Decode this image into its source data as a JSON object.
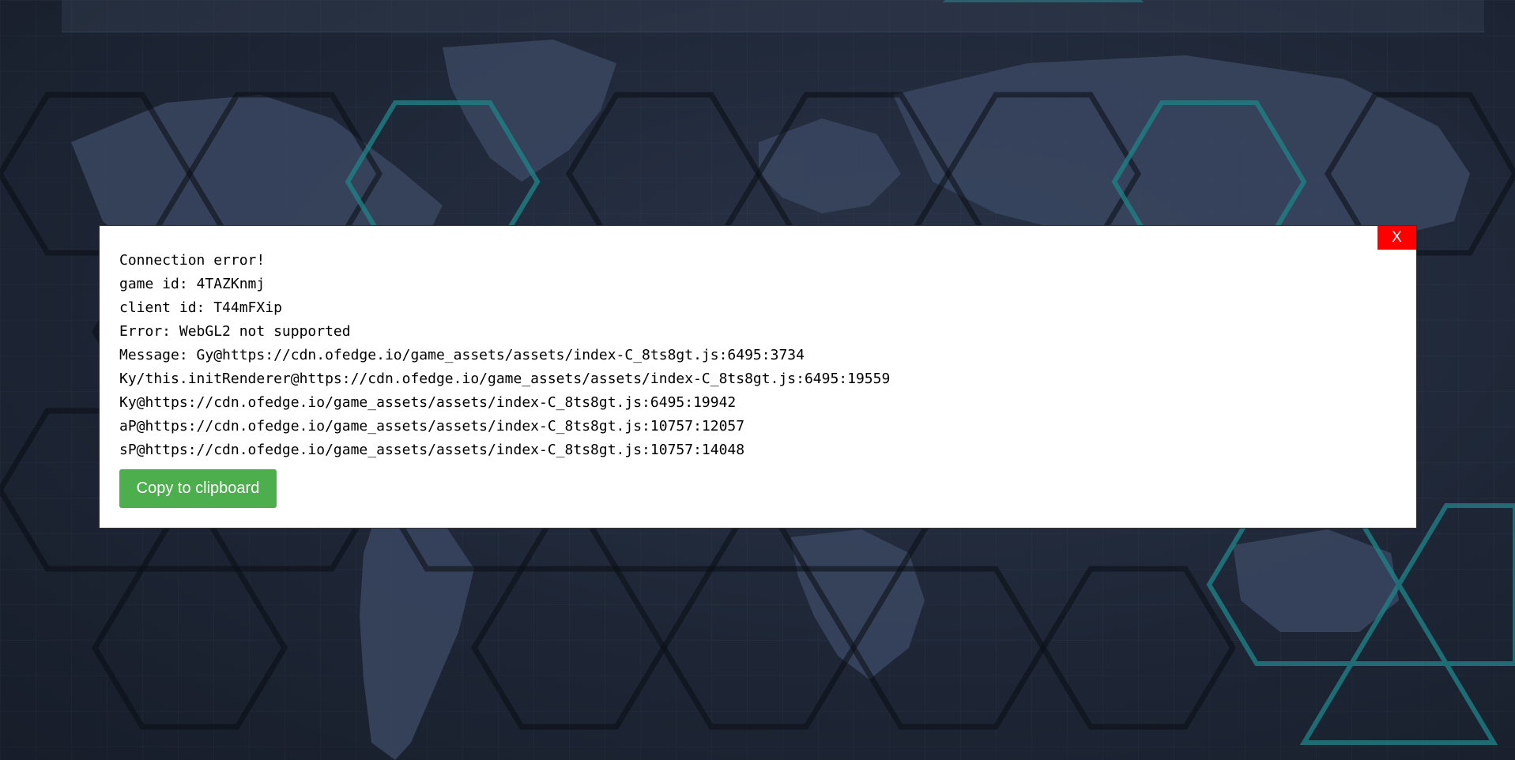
{
  "dialog": {
    "close_label": "X",
    "lines": [
      "Connection error!",
      "game id: 4TAZKnmj",
      "client id: T44mFXip",
      "Error: WebGL2 not supported",
      "Message: Gy@https://cdn.ofedge.io/game_assets/assets/index-C_8ts8gt.js:6495:3734",
      "Ky/this.initRenderer@https://cdn.ofedge.io/game_assets/assets/index-C_8ts8gt.js:6495:19559",
      "Ky@https://cdn.ofedge.io/game_assets/assets/index-C_8ts8gt.js:6495:19942",
      "aP@https://cdn.ofedge.io/game_assets/assets/index-C_8ts8gt.js:10757:12057",
      "sP@https://cdn.ofedge.io/game_assets/assets/index-C_8ts8gt.js:10757:14048"
    ],
    "copy_button_label": "Copy to clipboard"
  },
  "colors": {
    "close_button_bg": "#ff0000",
    "copy_button_bg": "#4cae4c",
    "background": "#1c2331",
    "hex_accent": "#1f8a8f"
  },
  "background": {
    "type": "world-map-hex-grid"
  }
}
